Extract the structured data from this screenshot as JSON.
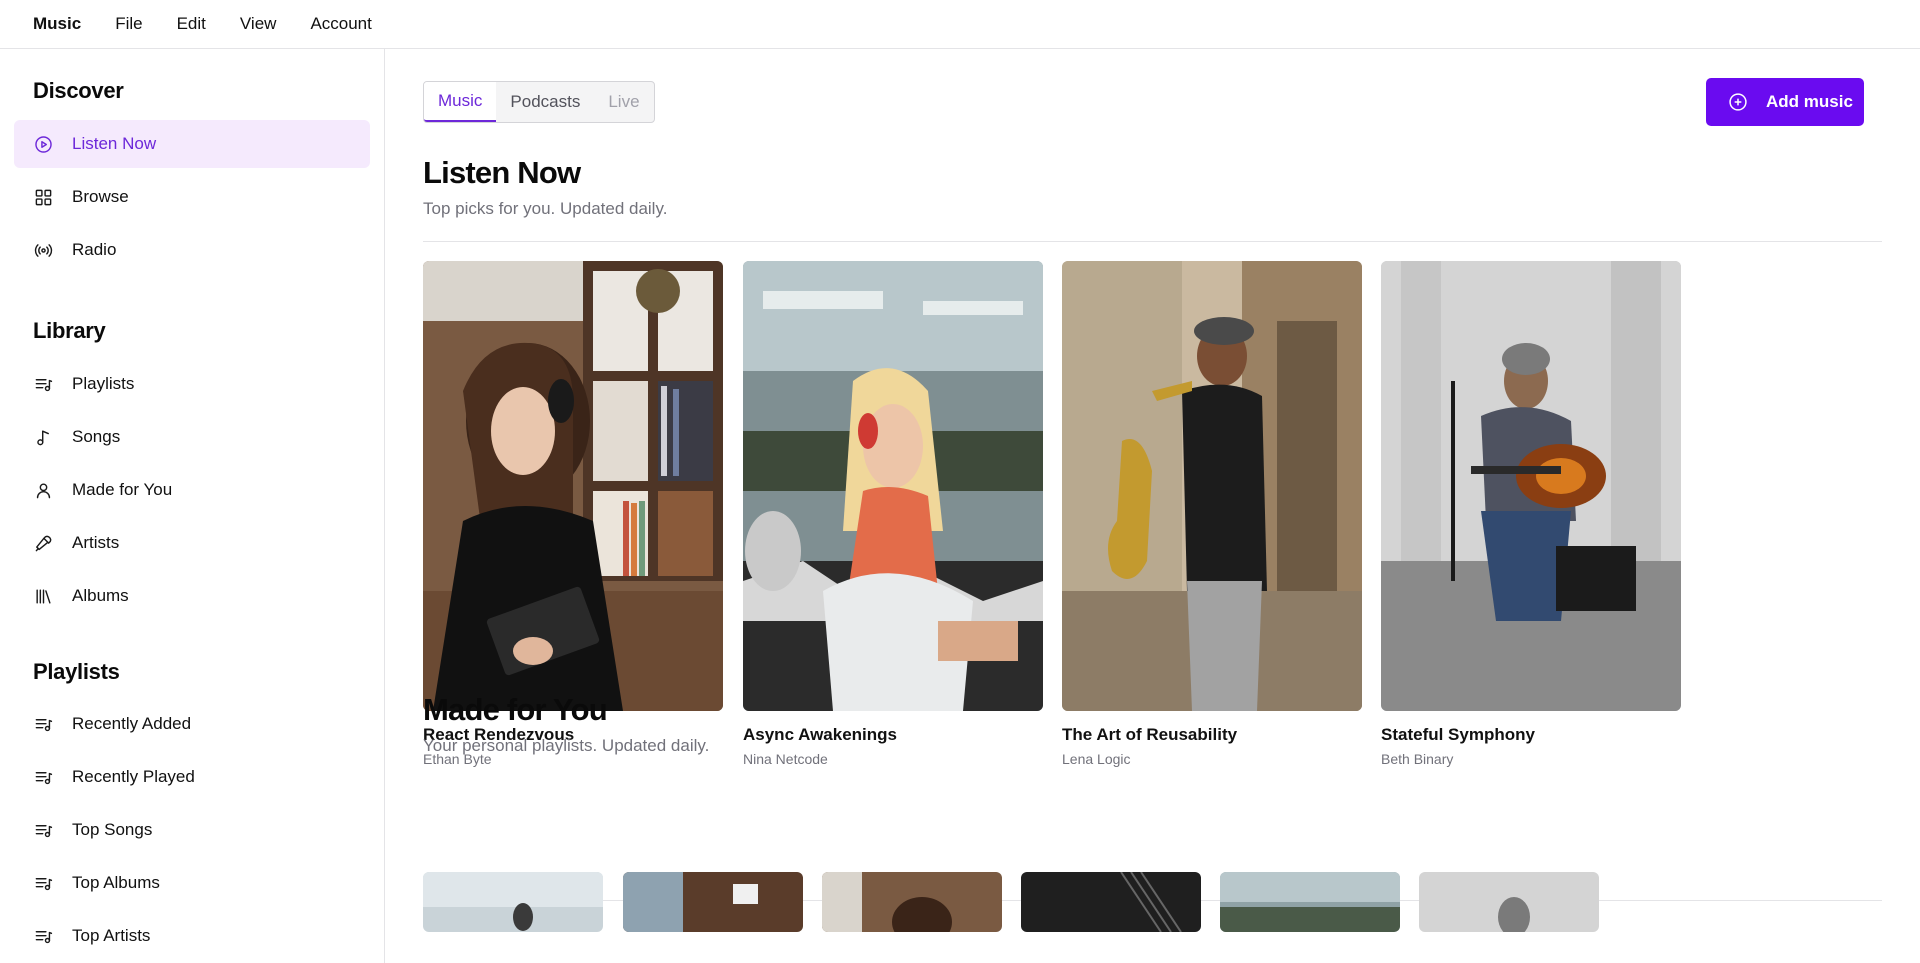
{
  "menubar": {
    "brand": "Music",
    "items": [
      "File",
      "Edit",
      "View",
      "Account"
    ]
  },
  "sidebar": {
    "discover": {
      "title": "Discover",
      "items": [
        {
          "label": "Listen Now",
          "icon": "play-circle-icon",
          "active": true
        },
        {
          "label": "Browse",
          "icon": "grid-icon"
        },
        {
          "label": "Radio",
          "icon": "radio-icon"
        }
      ]
    },
    "library": {
      "title": "Library",
      "items": [
        {
          "label": "Playlists",
          "icon": "list-music-icon"
        },
        {
          "label": "Songs",
          "icon": "music-note-icon"
        },
        {
          "label": "Made for You",
          "icon": "user-icon"
        },
        {
          "label": "Artists",
          "icon": "mic-icon"
        },
        {
          "label": "Albums",
          "icon": "library-icon"
        }
      ]
    },
    "playlists": {
      "title": "Playlists",
      "items": [
        {
          "label": "Recently Added",
          "icon": "list-music-icon"
        },
        {
          "label": "Recently Played",
          "icon": "list-music-icon"
        },
        {
          "label": "Top Songs",
          "icon": "list-music-icon"
        },
        {
          "label": "Top Albums",
          "icon": "list-music-icon"
        },
        {
          "label": "Top Artists",
          "icon": "list-music-icon"
        }
      ]
    }
  },
  "main": {
    "tabs": [
      {
        "label": "Music",
        "active": true
      },
      {
        "label": "Podcasts"
      },
      {
        "label": "Live",
        "disabled": true
      }
    ],
    "add_button": "Add music",
    "listen_now": {
      "title": "Listen Now",
      "subtitle": "Top picks for you. Updated daily.",
      "albums": [
        {
          "title": "React Rendezvous",
          "artist": "Ethan Byte"
        },
        {
          "title": "Async Awakenings",
          "artist": "Nina Netcode"
        },
        {
          "title": "The Art of Reusability",
          "artist": "Lena Logic"
        },
        {
          "title": "Stateful Symphony",
          "artist": "Beth Binary"
        }
      ]
    },
    "made_for_you": {
      "title": "Made for You",
      "subtitle": "Your personal playlists. Updated daily."
    }
  },
  "colors": {
    "accent": "#6a0bf0",
    "accent_text": "#6d28d9",
    "active_bg": "#f5eafd",
    "muted": "#71717a",
    "border": "#e4e4e7"
  }
}
